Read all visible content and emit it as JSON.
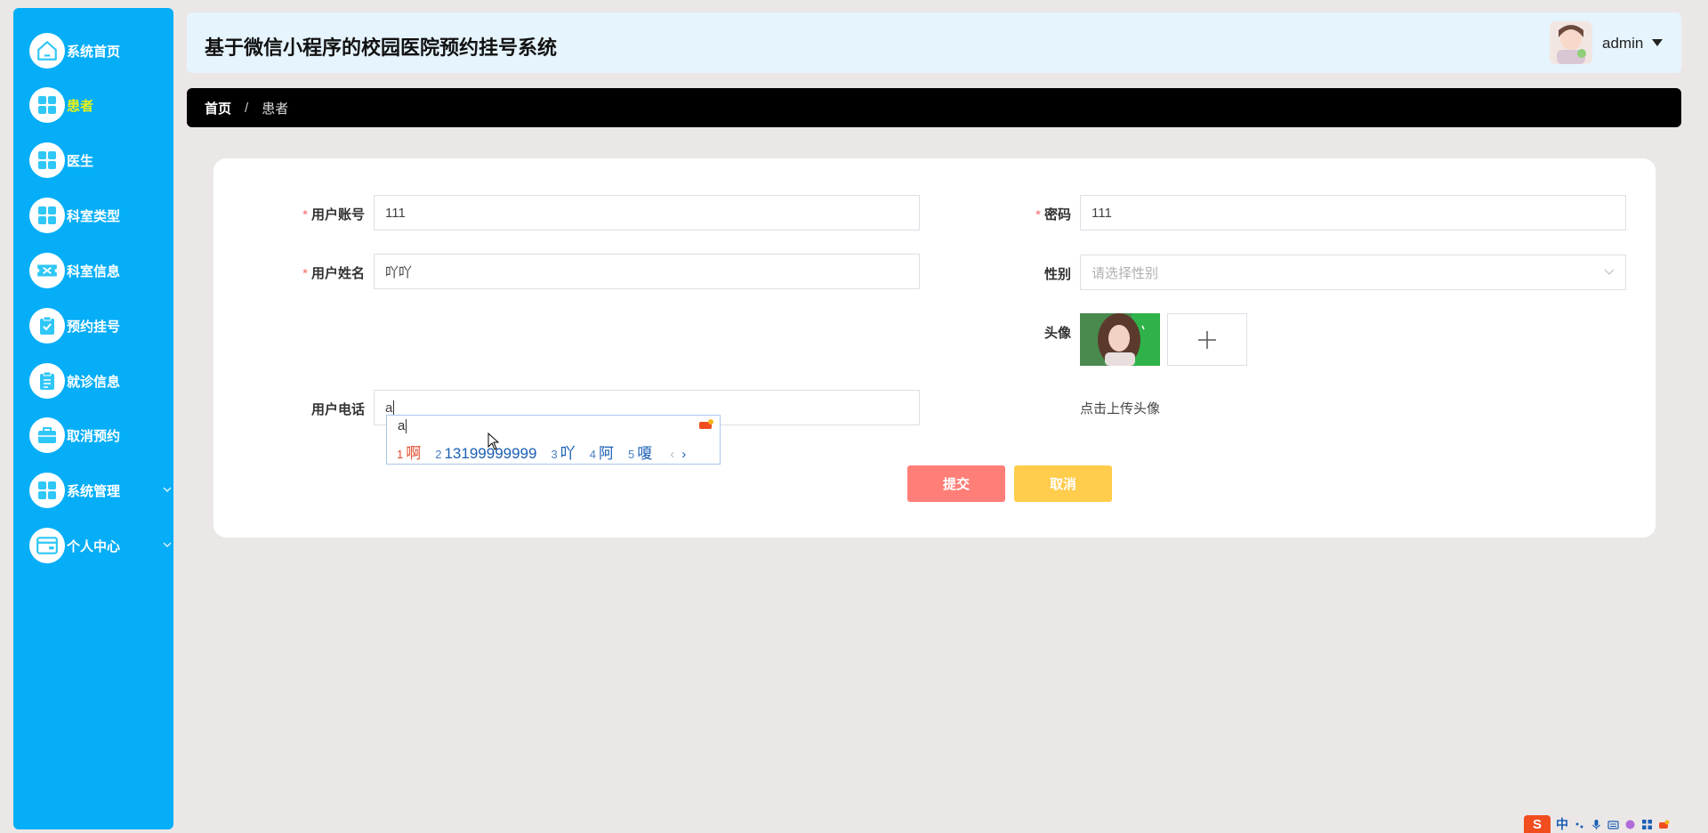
{
  "app": {
    "title": "基于微信小程序的校园医院预约挂号系统"
  },
  "header": {
    "username": "admin"
  },
  "sidebar": {
    "items": [
      {
        "label": "系统首页",
        "icon": "home-icon",
        "active": false,
        "expandable": false
      },
      {
        "label": "患者",
        "icon": "grid-icon",
        "active": true,
        "expandable": false
      },
      {
        "label": "医生",
        "icon": "grid-icon",
        "active": false,
        "expandable": false
      },
      {
        "label": "科室类型",
        "icon": "grid-icon",
        "active": false,
        "expandable": false
      },
      {
        "label": "科室信息",
        "icon": "ticket-icon",
        "active": false,
        "expandable": false
      },
      {
        "label": "预约挂号",
        "icon": "clipboard-check-icon",
        "active": false,
        "expandable": false
      },
      {
        "label": "就诊信息",
        "icon": "clipboard-icon",
        "active": false,
        "expandable": false
      },
      {
        "label": "取消预约",
        "icon": "briefcase-icon",
        "active": false,
        "expandable": false
      },
      {
        "label": "系统管理",
        "icon": "grid-icon",
        "active": false,
        "expandable": true
      },
      {
        "label": "个人中心",
        "icon": "card-icon",
        "active": false,
        "expandable": true
      }
    ]
  },
  "breadcrumb": {
    "home": "首页",
    "separator": "/",
    "current": "患者"
  },
  "form": {
    "account": {
      "label": "用户账号",
      "value": "111",
      "required": true
    },
    "password": {
      "label": "密码",
      "value": "111",
      "required": true
    },
    "name": {
      "label": "用户姓名",
      "value": "吖吖",
      "required": true
    },
    "gender": {
      "label": "性别",
      "placeholder": "请选择性别",
      "value": ""
    },
    "avatar": {
      "label": "头像",
      "upload_tip": "点击上传头像"
    },
    "phone": {
      "label": "用户电话",
      "value": "a"
    },
    "submit_label": "提交",
    "cancel_label": "取消"
  },
  "ime": {
    "composition": "a",
    "candidates": [
      {
        "num": "1",
        "text": "啊"
      },
      {
        "num": "2",
        "text": "13199999999"
      },
      {
        "num": "3",
        "text": "吖"
      },
      {
        "num": "4",
        "text": "阿"
      },
      {
        "num": "5",
        "text": "嗄"
      }
    ],
    "prev": "‹",
    "next": "›"
  },
  "tray": {
    "ime_logo": "S",
    "ime_mode": "中"
  },
  "colors": {
    "sidebar": "#05aef7",
    "header": "#e6f4fd",
    "breadcrumb": "#000000",
    "active_nav": "#e8f216",
    "submit": "#ff7f78",
    "cancel": "#ffcc4c",
    "required": "#f56c6c"
  }
}
